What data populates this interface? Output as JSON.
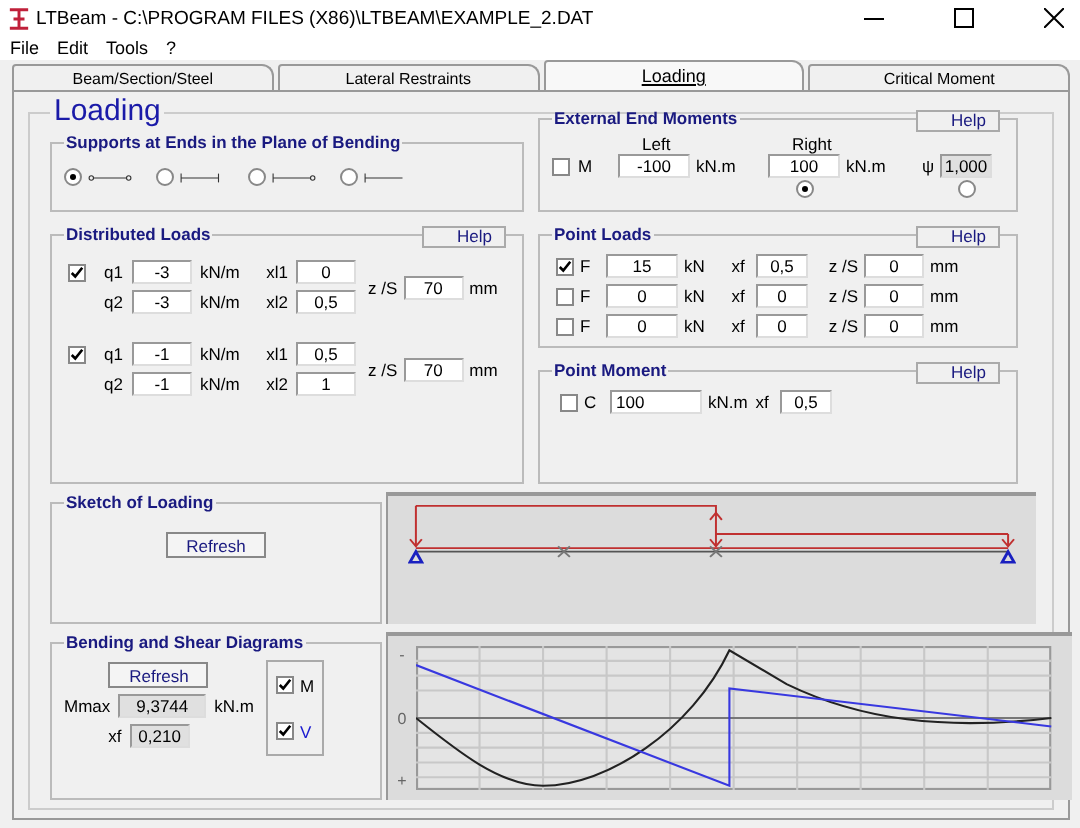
{
  "window": {
    "title": "LTBeam - C:\\PROGRAM FILES (X86)\\LTBEAM\\EXAMPLE_2.DAT"
  },
  "menu": [
    "File",
    "Edit",
    "Tools",
    "?"
  ],
  "tabs": [
    {
      "label": "Beam/Section/Steel",
      "selected": false
    },
    {
      "label": "Lateral Restraints",
      "selected": false
    },
    {
      "label": "Loading",
      "selected": true
    },
    {
      "label": "Critical Moment",
      "selected": false
    }
  ],
  "heading": "Loading",
  "supports": {
    "title": "Supports at Ends in the Plane of Bending",
    "options": [
      {
        "kind": "pin-pin",
        "selected": true
      },
      {
        "kind": "fix-fix",
        "selected": false
      },
      {
        "kind": "fix-pin",
        "selected": false
      },
      {
        "kind": "fix-free",
        "selected": false
      }
    ]
  },
  "distributed_loads": {
    "title": "Distributed Loads",
    "help": "Help",
    "groups": [
      {
        "checked": true,
        "rows": [
          {
            "label": "q1",
            "value": "-3",
            "unit": "kN/m",
            "x_label": "xl1",
            "x_value": "0"
          },
          {
            "label": "q2",
            "value": "-3",
            "unit": "kN/m",
            "x_label": "xl2",
            "x_value": "0,5"
          }
        ],
        "z_label": "z /S",
        "z_value": "70",
        "z_unit": "mm"
      },
      {
        "checked": true,
        "rows": [
          {
            "label": "q1",
            "value": "-1",
            "unit": "kN/m",
            "x_label": "xl1",
            "x_value": "0,5"
          },
          {
            "label": "q2",
            "value": "-1",
            "unit": "kN/m",
            "x_label": "xl2",
            "x_value": "1"
          }
        ],
        "z_label": "z /S",
        "z_value": "70",
        "z_unit": "mm"
      }
    ]
  },
  "end_moments": {
    "title": "External End Moments",
    "help": "Help",
    "label": "M",
    "checked": false,
    "left": {
      "label": "Left",
      "value": "-100",
      "unit": "kN.m"
    },
    "right": {
      "label": "Right",
      "value": "100",
      "unit": "kN.m",
      "selected": true
    },
    "psi": {
      "label": "ψ",
      "value": "1,000",
      "selected": false
    }
  },
  "point_loads": {
    "title": "Point Loads",
    "help": "Help",
    "rows": [
      {
        "label": "F",
        "checked": true,
        "value": "15",
        "unit": "kN",
        "x_label": "xf",
        "x_value": "0,5",
        "z_label": "z /S",
        "z_value": "0",
        "z_unit": "mm"
      },
      {
        "label": "F",
        "checked": false,
        "value": "0",
        "unit": "kN",
        "x_label": "xf",
        "x_value": "0",
        "z_label": "z /S",
        "z_value": "0",
        "z_unit": "mm"
      },
      {
        "label": "F",
        "checked": false,
        "value": "0",
        "unit": "kN",
        "x_label": "xf",
        "x_value": "0",
        "z_label": "z /S",
        "z_value": "0",
        "z_unit": "mm"
      }
    ]
  },
  "point_moment": {
    "title": "Point Moment",
    "help": "Help",
    "label": "C",
    "checked": false,
    "value": "100",
    "unit": "kN.m",
    "x_label": "xf",
    "x_value": "0,5"
  },
  "sketch": {
    "title": "Sketch of Loading",
    "button": "Refresh"
  },
  "diagrams": {
    "title": "Bending and Shear Diagrams",
    "button": "Refresh",
    "mmax": {
      "label": "Mmax",
      "value": "9,3744",
      "unit": "kN.m"
    },
    "xf": {
      "label": "xf",
      "value": "0,210"
    },
    "toggles": [
      {
        "label": "M",
        "checked": true
      },
      {
        "label": "V",
        "checked": true
      }
    ],
    "axis_labels": [
      "-",
      "0",
      "+"
    ]
  }
}
